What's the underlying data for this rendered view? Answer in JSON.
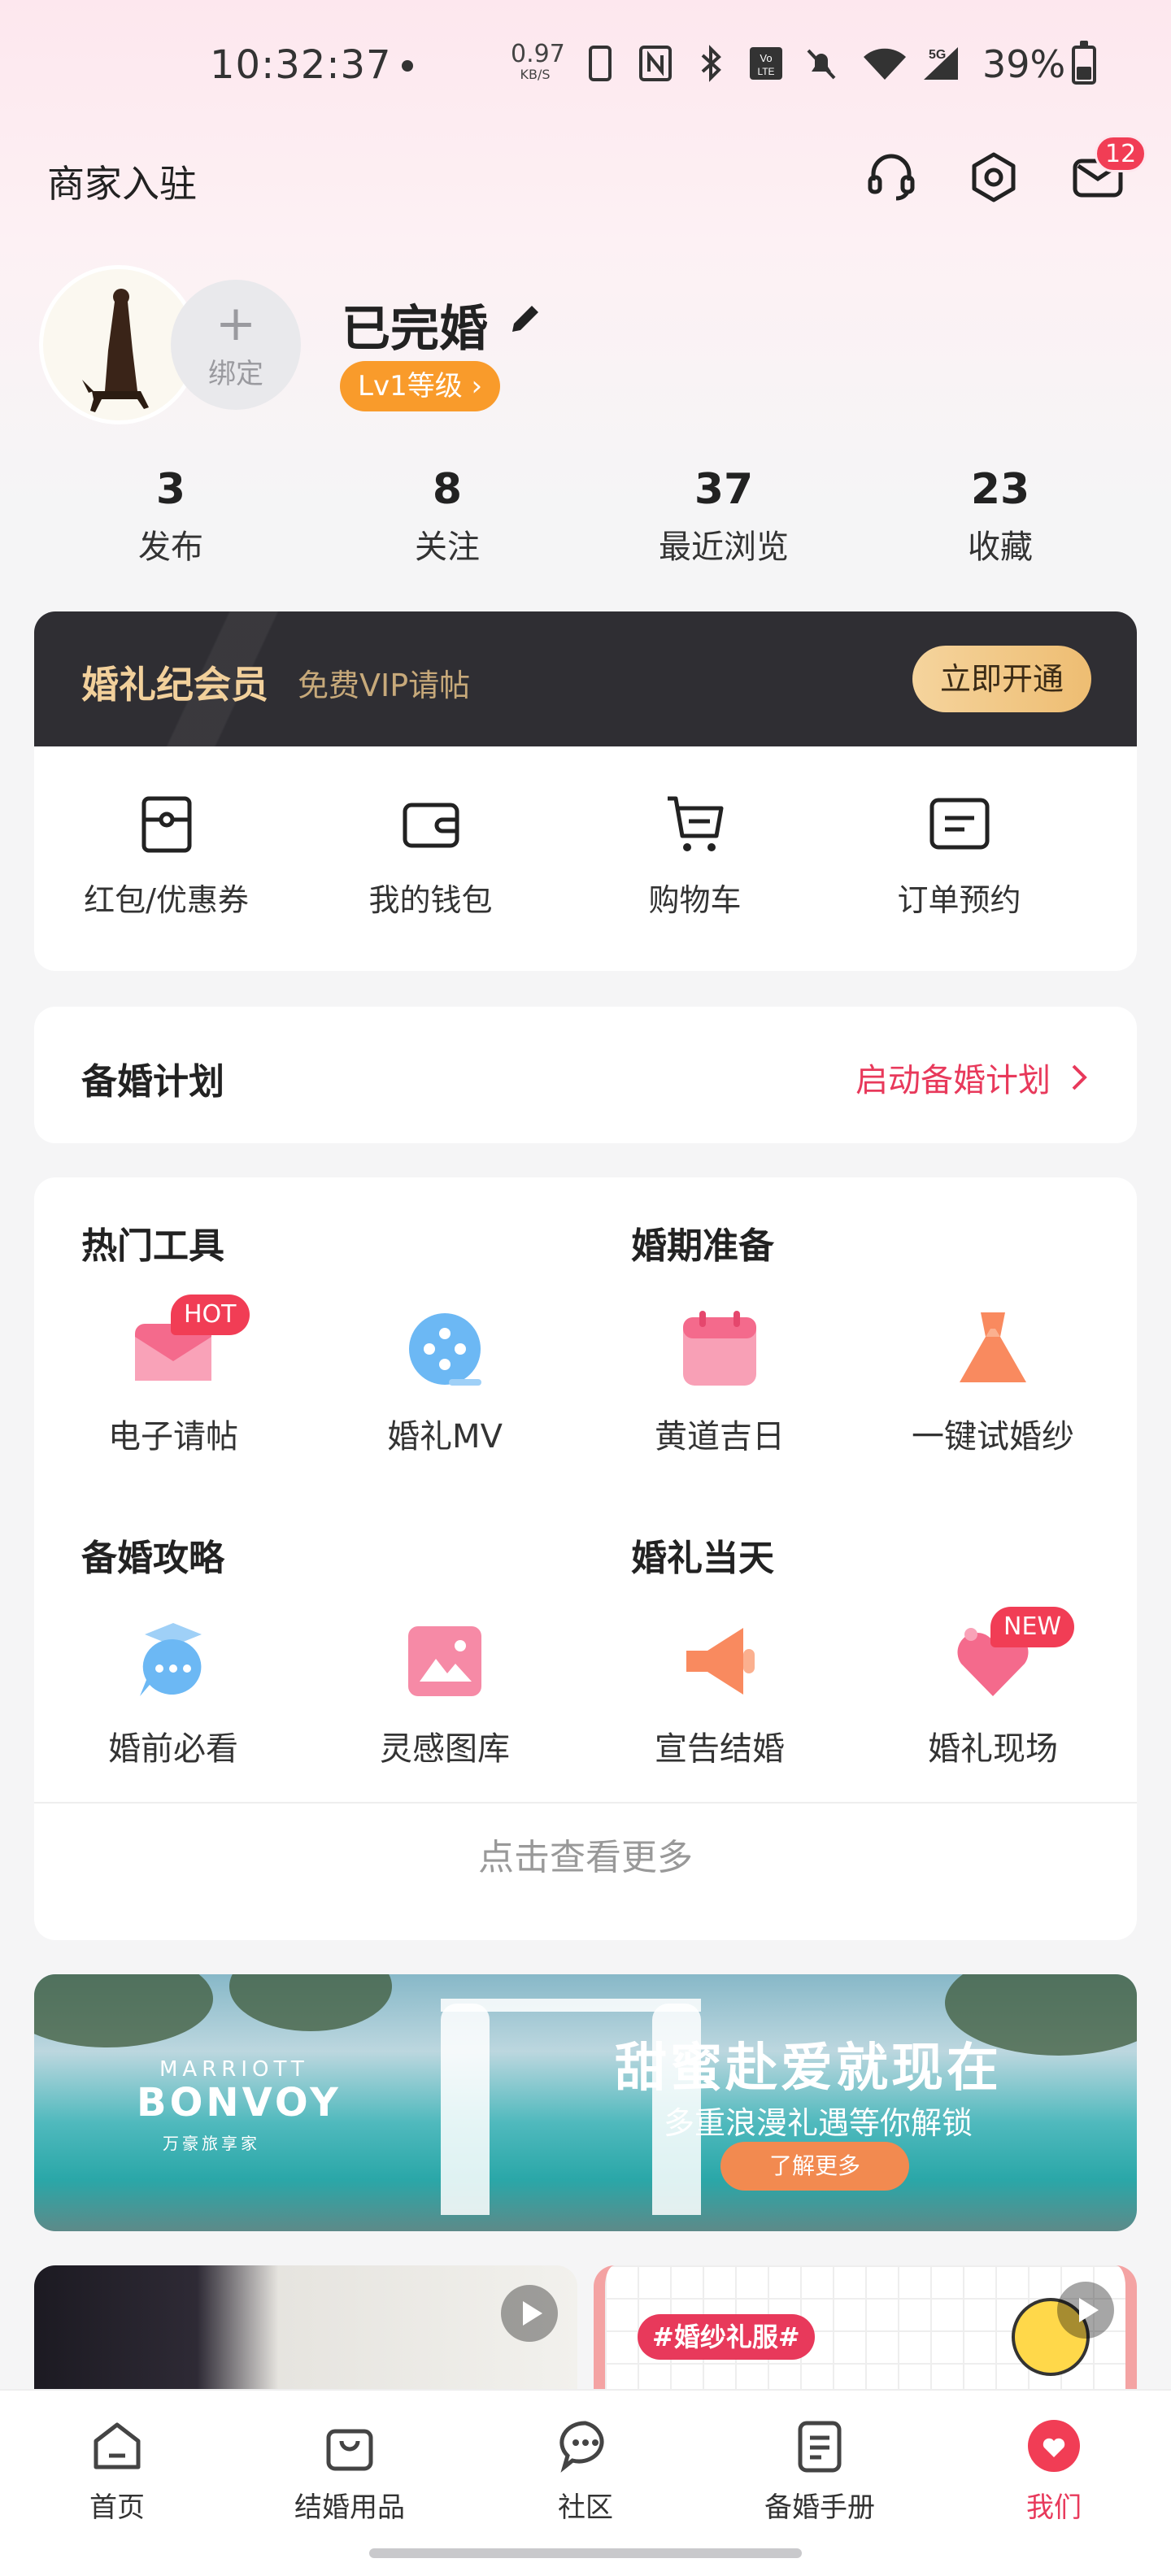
{
  "status_bar": {
    "time": "10:32:37",
    "speed_value": "0.97",
    "speed_unit": "KB/S",
    "battery": "39%",
    "battery_level": 0.39,
    "icons": [
      "vibrate-icon",
      "nfc-icon",
      "bluetooth-icon",
      "volte-icon",
      "mute-icon",
      "wifi-icon",
      "signal-5g-icon",
      "battery-icon"
    ]
  },
  "header": {
    "merchant_label": "商家入驻",
    "icons": [
      "headset-icon",
      "settings-icon",
      "mail-icon"
    ],
    "message_badge": "12"
  },
  "profile": {
    "bind_label": "绑定",
    "nickname": "已完婚",
    "level": "Lv1等级",
    "stats": [
      {
        "num": "3",
        "label": "发布"
      },
      {
        "num": "8",
        "label": "关注"
      },
      {
        "num": "37",
        "label": "最近浏览"
      },
      {
        "num": "23",
        "label": "收藏"
      }
    ]
  },
  "vip": {
    "title": "婚礼纪会员",
    "subtitle": "免费VIP请帖",
    "button": "立即开通",
    "quick_links": [
      {
        "label": "红包/优惠券",
        "icon": "coupon-icon"
      },
      {
        "label": "我的钱包",
        "icon": "wallet-icon"
      },
      {
        "label": "购物车",
        "icon": "cart-icon"
      },
      {
        "label": "订单预约",
        "icon": "order-icon"
      }
    ]
  },
  "plan": {
    "title": "备婚计划",
    "link": "启动备婚计划"
  },
  "tools": {
    "sections": [
      "热门工具",
      "婚期准备",
      "备婚攻略",
      "婚礼当天"
    ],
    "items": [
      {
        "label": "电子请帖",
        "icon": "invitation-icon",
        "badge": "HOT"
      },
      {
        "label": "婚礼MV",
        "icon": "film-reel-icon"
      },
      {
        "label": "黄道吉日",
        "icon": "calendar-icon"
      },
      {
        "label": "一键试婚纱",
        "icon": "dress-icon"
      },
      {
        "label": "婚前必看",
        "icon": "graduation-chat-icon"
      },
      {
        "label": "灵感图库",
        "icon": "gallery-icon"
      },
      {
        "label": "宣告结婚",
        "icon": "megaphone-icon"
      },
      {
        "label": "婚礼现场",
        "icon": "heart-tag-icon",
        "badge": "NEW"
      }
    ],
    "more": "点击查看更多"
  },
  "banner": {
    "brand_line1": "MARRIOTT",
    "brand_line2": "BONVOY",
    "brand_line3": "万豪旅享家",
    "headline": "甜蜜赴爱就现在",
    "subline": "多重浪漫礼遇等你解锁",
    "cta": "了解更多"
  },
  "feed": {
    "right_tag": "#婚纱礼服#"
  },
  "bottom_nav": [
    {
      "label": "首页",
      "icon": "home-icon"
    },
    {
      "label": "结婚用品",
      "icon": "shopping-bag-icon"
    },
    {
      "label": "社区",
      "icon": "chat-bubble-icon"
    },
    {
      "label": "备婚手册",
      "icon": "handbook-icon"
    },
    {
      "label": "我们",
      "icon": "us-icon",
      "active": true
    }
  ],
  "colors": {
    "accent": "#e8395b",
    "badge": "#f13d55",
    "level": "#f99b2b",
    "vip_bar": "#2f2e33",
    "vip_gold": "#f2d09b"
  }
}
